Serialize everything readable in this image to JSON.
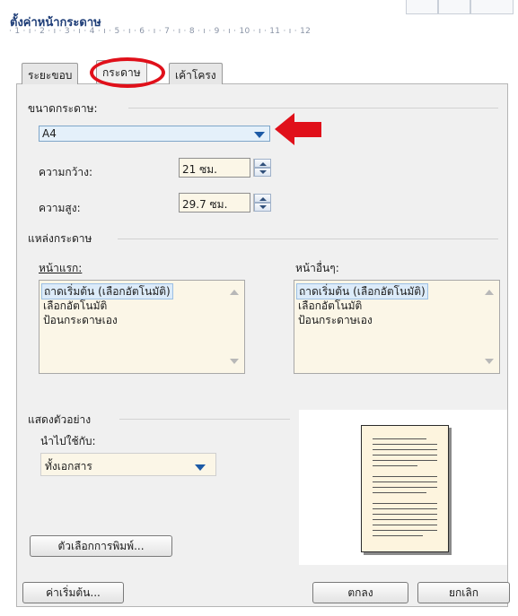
{
  "window": {
    "title": "ตั้งค่าหน้ากระดาษ",
    "ruler_text": "· 1 · ı · 2 · ı · 3 · ı · 4 · ı · 5 · ı · 6 · ı · 7 · ı · 8 · ı · 9 · ı · 10 · ı · 11 · ı · 12"
  },
  "tabs": [
    {
      "label": "ระยะขอบ",
      "active": false
    },
    {
      "label": "กระดาษ",
      "active": true
    },
    {
      "label": "เค้าโครง",
      "active": false
    }
  ],
  "paper_size": {
    "group_label": "ขนาดกระดาษ:",
    "selected": "A4",
    "width_label": "ความกว้าง:",
    "width_value": "21 ซม.",
    "height_label": "ความสูง:",
    "height_value": "29.7 ซม."
  },
  "paper_source": {
    "group_label": "แหล่งกระดาษ",
    "first_page": {
      "label": "หน้าแรก:",
      "items": [
        "ถาดเริ่มต้น (เลือกอัตโนมัติ)",
        "เลือกอัตโนมัติ",
        "ป้อนกระดาษเอง"
      ]
    },
    "other_pages": {
      "label": "หน้าอื่นๆ:",
      "items": [
        "ถาดเริ่มต้น (เลือกอัตโนมัติ)",
        "เลือกอัตโนมัติ",
        "ป้อนกระดาษเอง"
      ]
    }
  },
  "preview": {
    "group_label": "แสดงตัวอย่าง",
    "apply_to_label": "นำไปใช้กับ:",
    "apply_to_value": "ทั้งเอกสาร",
    "print_options_button": "ตัวเลือกการพิมพ์..."
  },
  "footer": {
    "default_button": "ค่าเริ่มต้น...",
    "ok_button": "ตกลง",
    "cancel_button": "ยกเลิก"
  },
  "colors": {
    "highlight": "#e0101a",
    "title": "#1f3e78",
    "accent_arrow": "#1c5aa6"
  }
}
